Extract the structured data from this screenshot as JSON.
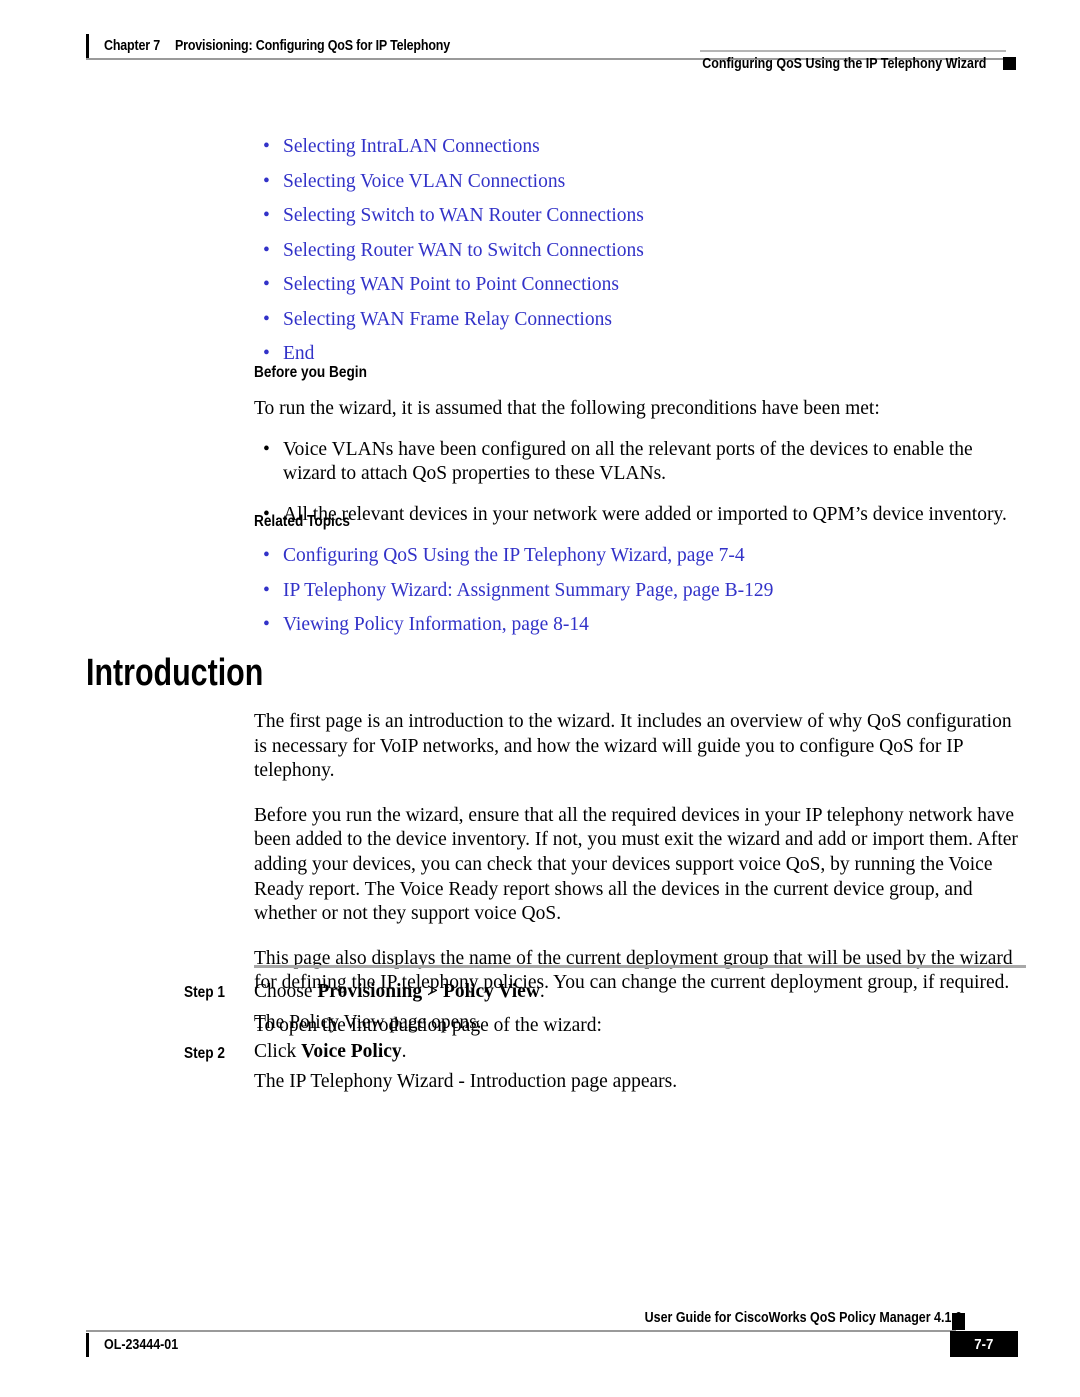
{
  "document": {
    "colors": {
      "link_blue": "#3232c8",
      "rule_gray": "#9a9a9a",
      "text_black": "#000000"
    }
  },
  "header": {
    "chapter_label": "Chapter 7",
    "chapter_title": "Provisioning: Configuring QoS for IP Telephony",
    "section_title": "Configuring QoS Using the IP Telephony Wizard"
  },
  "topic_links": [
    "Selecting IntraLAN Connections",
    "Selecting Voice VLAN Connections",
    "Selecting Switch to WAN Router Connections",
    "Selecting Router WAN to Switch Connections",
    "Selecting WAN Point to Point Connections",
    "Selecting WAN Frame Relay Connections",
    "End"
  ],
  "before_you_begin": {
    "heading": "Before you Begin",
    "intro": "To run the wizard, it is assumed that the following preconditions have been met:",
    "items": [
      "Voice VLANs have been configured on all the relevant ports of the devices to enable the wizard to attach QoS properties to these VLANs.",
      "All the relevant devices in your network were added or imported to QPM’s device inventory."
    ]
  },
  "related_topics": {
    "heading": "Related Topics",
    "items": [
      "Configuring QoS Using the IP Telephony Wizard, page 7-4",
      "IP Telephony Wizard: Assignment Summary Page, page B-129",
      "Viewing Policy Information, page 8-14"
    ]
  },
  "introduction": {
    "heading": "Introduction",
    "paragraphs": [
      "The first page is an introduction to the wizard. It includes an overview of why QoS configuration is necessary for VoIP networks, and how the wizard will guide you to configure QoS for IP telephony.",
      "Before you run the wizard, ensure that all the required devices in your IP telephony network have been added to the device inventory. If not, you must exit the wizard and add or import them. After adding your devices, you can check that your devices support voice QoS, by running the Voice Ready report. The Voice Ready report shows all the devices in the current device group, and whether or not they support voice QoS.",
      "This page also displays the name of the current deployment group that will be used by the wizard for defining the IP telephony policies. You can change the current deployment group, if required.",
      "To open the Introduction page of the wizard:"
    ]
  },
  "steps": [
    {
      "label": "Step 1",
      "text_before": "Choose ",
      "text_bold": "Provisioning > Policy View",
      "text_after": ".",
      "result": "The Policy View page opens."
    },
    {
      "label": "Step 2",
      "text_before": "Click ",
      "text_bold": "Voice Policy",
      "text_after": ".",
      "result": "The IP Telephony Wizard - Introduction page appears."
    }
  ],
  "footer": {
    "doc_id": "OL-23444-01",
    "guide_title": "User Guide for CiscoWorks QoS Policy Manager 4.1.6",
    "page_number": "7-7"
  }
}
